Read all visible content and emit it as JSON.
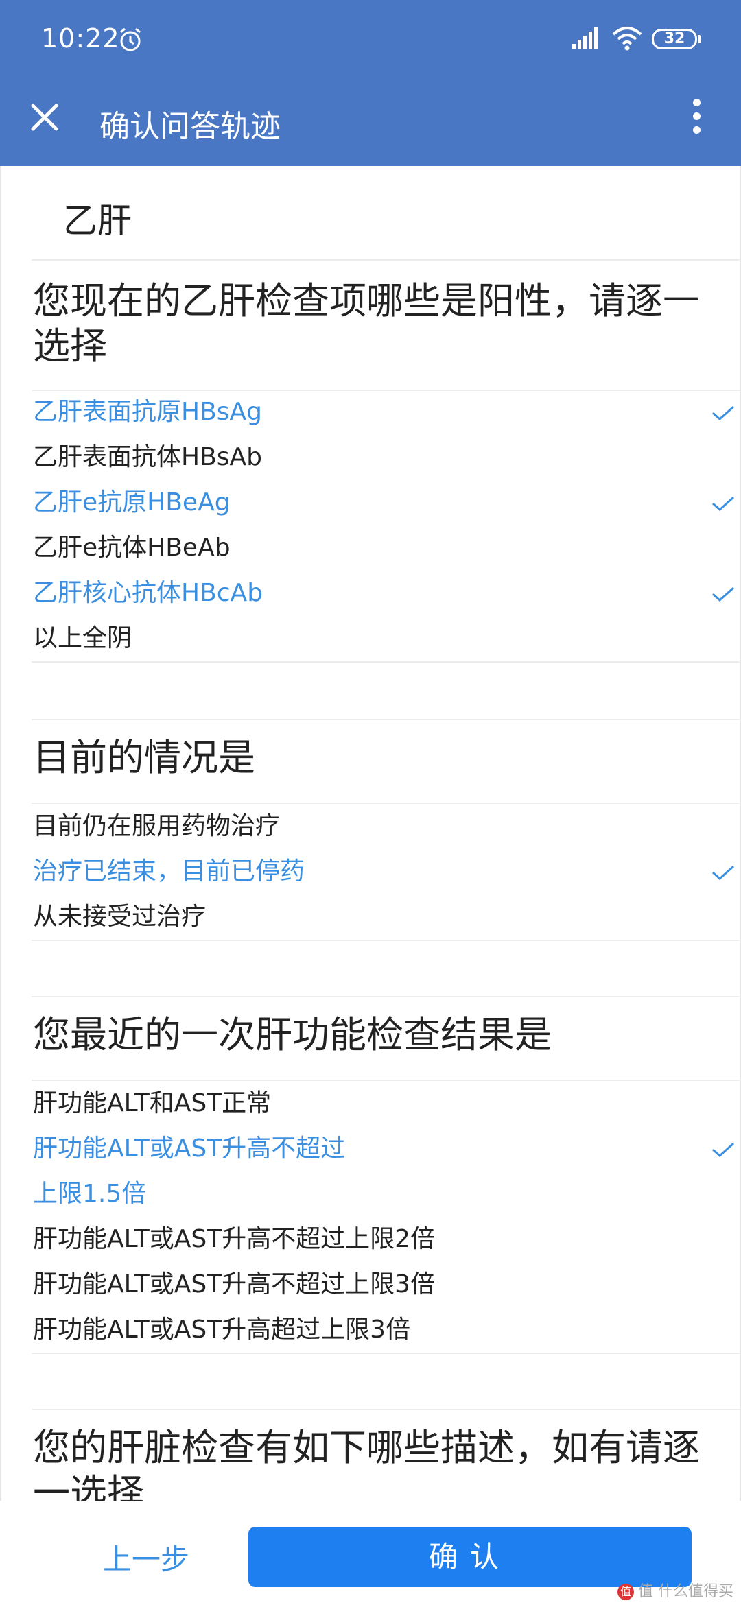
{
  "status_bar": {
    "time": "10:22",
    "battery": "32"
  },
  "app_bar": {
    "title": "确认问答轨迹"
  },
  "category": "乙肝",
  "questions": [
    {
      "title": "您现在的乙肝检查项哪些是阳性，请逐一选择",
      "options": [
        {
          "label": "乙肝表面抗原HBsAg",
          "selected": true
        },
        {
          "label": "乙肝表面抗体HBsAb",
          "selected": false
        },
        {
          "label": "乙肝e抗原HBeAg",
          "selected": true
        },
        {
          "label": "乙肝e抗体HBeAb",
          "selected": false
        },
        {
          "label": "乙肝核心抗体HBcAb",
          "selected": true
        },
        {
          "label": "以上全阴",
          "selected": false
        }
      ]
    },
    {
      "title": "目前的情况是",
      "options": [
        {
          "label": "目前仍在服用药物治疗",
          "selected": false
        },
        {
          "label": "治疗已结束，目前已停药",
          "selected": true
        },
        {
          "label": "从未接受过治疗",
          "selected": false
        }
      ]
    },
    {
      "title": "您最近的一次肝功能检查结果是",
      "options": [
        {
          "label": "肝功能ALT和AST正常",
          "selected": false
        },
        {
          "label": "肝功能ALT或AST升高不超过",
          "label_line2": "上限1.5倍",
          "selected": true
        },
        {
          "label": "肝功能ALT或AST升高不超过上限2倍",
          "selected": false
        },
        {
          "label": "肝功能ALT或AST升高不超过上限3倍",
          "selected": false
        },
        {
          "label": "肝功能ALT或AST升高超过上限3倍",
          "selected": false
        }
      ]
    },
    {
      "title": "您的肝脏检查有如下哪些描述，如有请逐一选择",
      "options": []
    }
  ],
  "bottom_bar": {
    "prev_label": "上一步",
    "confirm_label": "确认"
  },
  "watermark": "值 什么值得买",
  "colors": {
    "header": "#4a77c4",
    "selected": "#3b8fe0",
    "confirm": "#1e7ff0"
  },
  "icons": [
    "alarm-icon",
    "signal-icon",
    "wifi-icon",
    "battery-icon",
    "close-icon",
    "more-vertical-icon",
    "check-icon"
  ]
}
